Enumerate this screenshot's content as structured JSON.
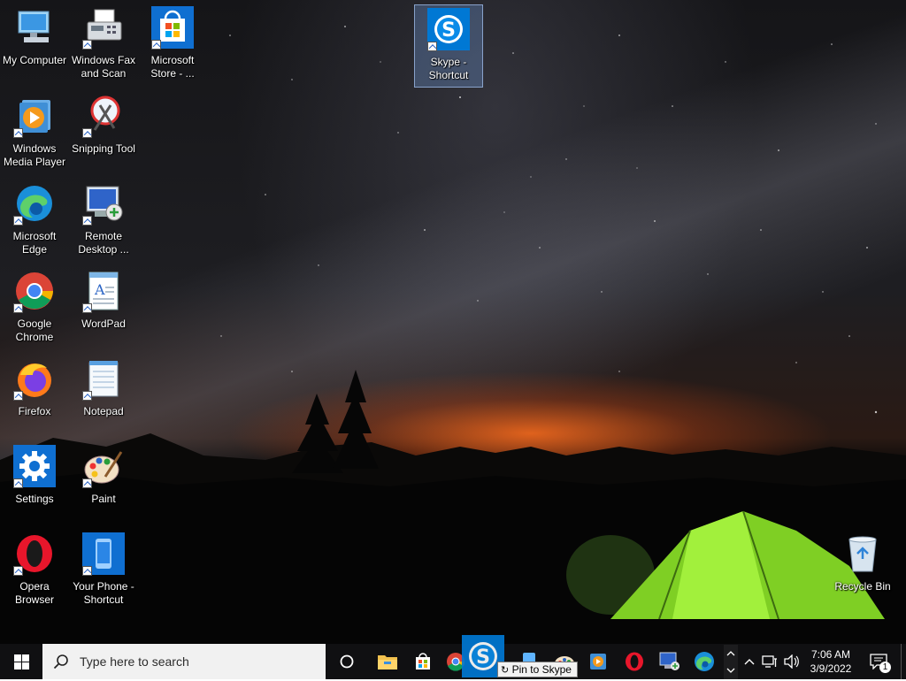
{
  "desktop": {
    "icons": [
      {
        "label": "My Computer"
      },
      {
        "label": "Windows Fax and Scan"
      },
      {
        "label": "Microsoft Store - ..."
      },
      {
        "label": "Skype - Shortcut"
      },
      {
        "label": "Windows Media Player"
      },
      {
        "label": "Snipping Tool"
      },
      {
        "label": "Microsoft Edge"
      },
      {
        "label": "Remote Desktop ..."
      },
      {
        "label": "Google Chrome"
      },
      {
        "label": "WordPad"
      },
      {
        "label": "Firefox"
      },
      {
        "label": "Notepad"
      },
      {
        "label": "Settings"
      },
      {
        "label": "Paint"
      },
      {
        "label": "Opera Browser"
      },
      {
        "label": "Your Phone - Shortcut"
      },
      {
        "label": "Recycle Bin"
      }
    ]
  },
  "taskbar": {
    "search_placeholder": "Type here to search",
    "tooltip": "Pin to Skype",
    "time": "7:06 AM",
    "date": "3/9/2022",
    "notification_count": "1"
  },
  "colors": {
    "taskbar": "#101012",
    "selection": "#6e96d2",
    "accent_blue": "#0078d4",
    "tent_green": "#8ee02a"
  }
}
